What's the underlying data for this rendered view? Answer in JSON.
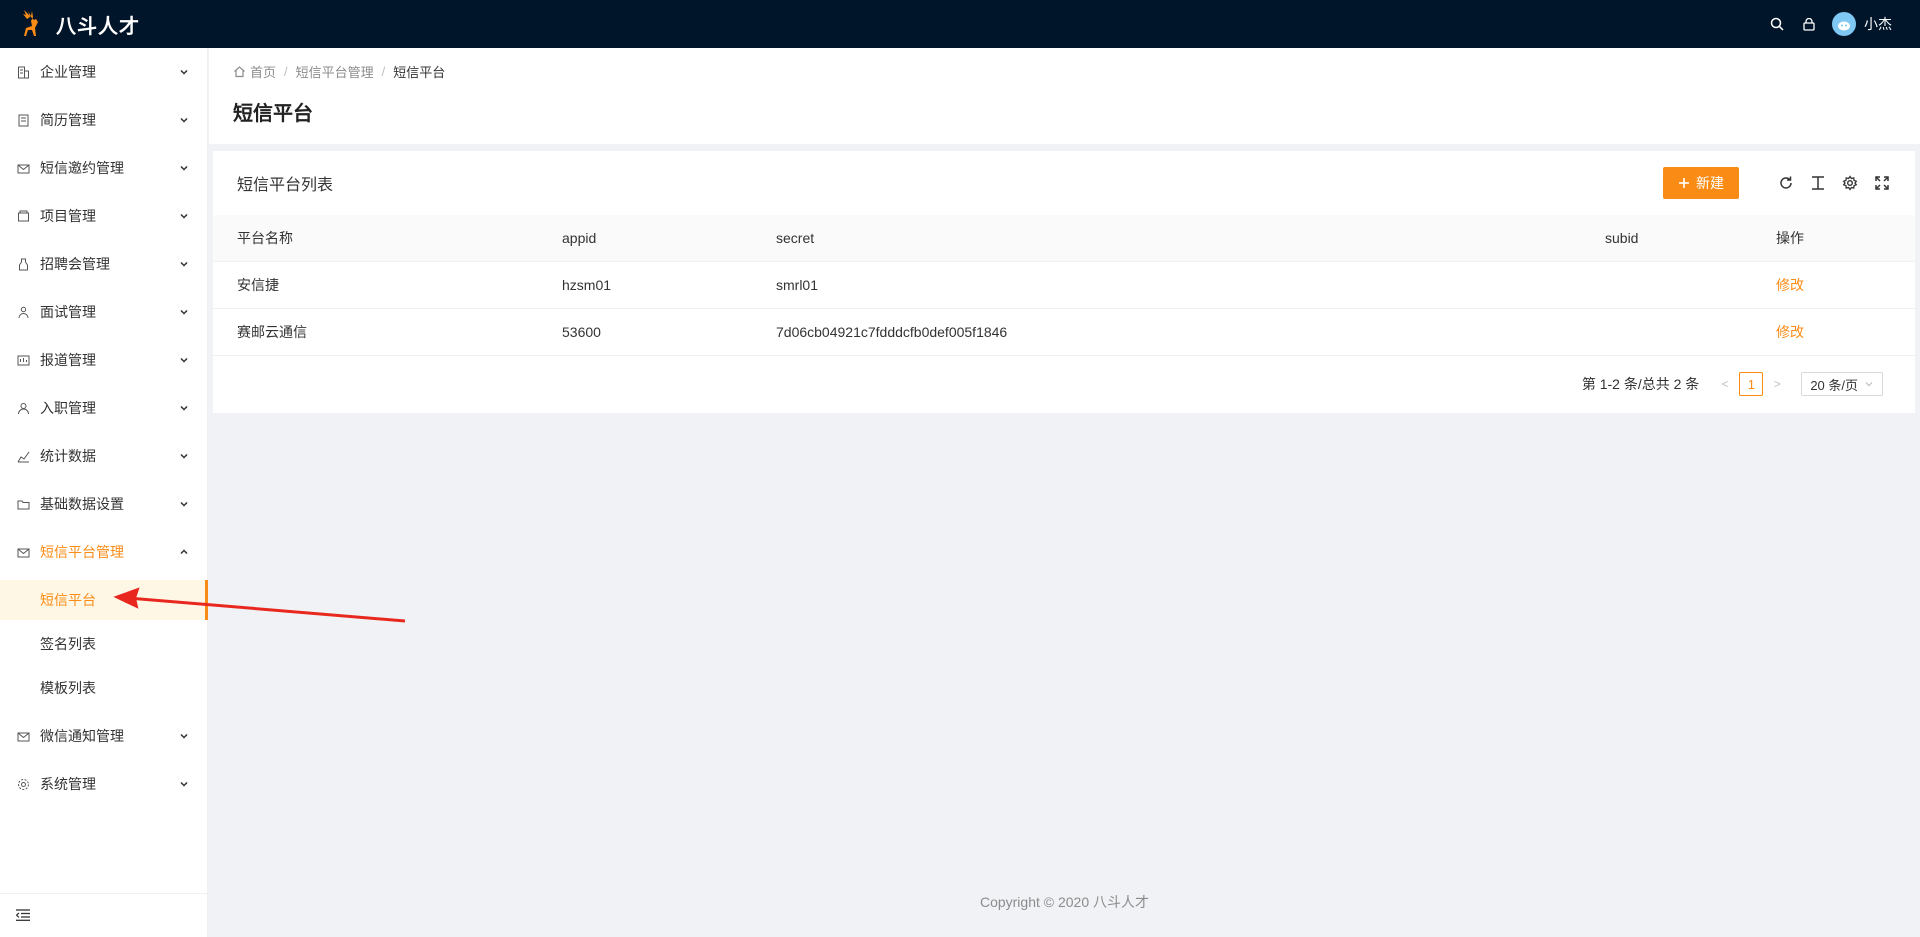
{
  "header": {
    "app_name": "八斗人才",
    "username": "小杰",
    "brand_color": "#fa8c16",
    "header_bg": "#001529"
  },
  "sidebar": {
    "items": [
      {
        "label": "企业管理",
        "icon": "building-icon"
      },
      {
        "label": "简历管理",
        "icon": "resume-icon"
      },
      {
        "label": "短信邀约管理",
        "icon": "mail-icon"
      },
      {
        "label": "项目管理",
        "icon": "project-icon"
      },
      {
        "label": "招聘会管理",
        "icon": "bottle-icon"
      },
      {
        "label": "面试管理",
        "icon": "users-icon"
      },
      {
        "label": "报道管理",
        "icon": "report-icon"
      },
      {
        "label": "入职管理",
        "icon": "user-icon"
      },
      {
        "label": "统计数据",
        "icon": "stats-icon"
      },
      {
        "label": "基础数据设置",
        "icon": "folder-icon"
      },
      {
        "label": "短信平台管理",
        "icon": "mail-icon"
      },
      {
        "label": "微信通知管理",
        "icon": "mail-icon"
      },
      {
        "label": "系统管理",
        "icon": "gear-icon"
      }
    ],
    "sub_items": [
      "短信平台",
      "签名列表",
      "模板列表"
    ]
  },
  "breadcrumb": {
    "home": "首页",
    "parent": "短信平台管理",
    "current": "短信平台"
  },
  "page": {
    "title": "短信平台"
  },
  "card": {
    "title": "短信平台列表",
    "new_button": "新建"
  },
  "table": {
    "columns": [
      "平台名称",
      "appid",
      "secret",
      "subid",
      "操作"
    ],
    "rows": [
      {
        "name": "安信捷",
        "appid": "hzsm01",
        "secret": "smrl01",
        "subid": "",
        "action": "修改"
      },
      {
        "name": "赛邮云通信",
        "appid": "53600",
        "secret": "7d06cb04921c7fdddcfb0def005f1846",
        "subid": "",
        "action": "修改"
      }
    ]
  },
  "pagination": {
    "total_text": "第 1-2 条/总共 2 条",
    "current_page": "1",
    "page_size": "20 条/页"
  },
  "footer": {
    "copyright": "Copyright",
    "year_company": "2020 八斗人才"
  }
}
